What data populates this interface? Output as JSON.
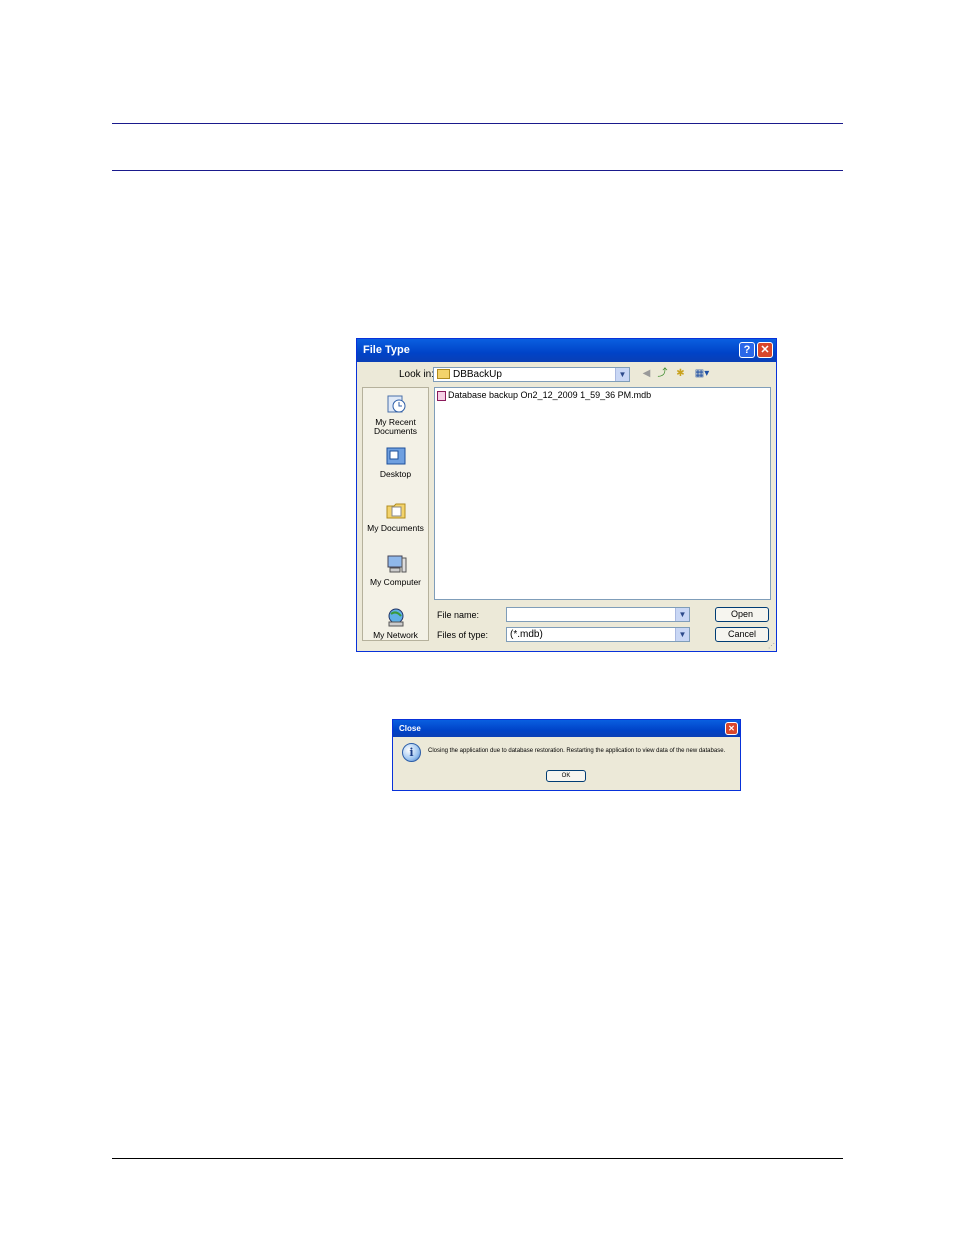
{
  "file_dialog": {
    "title": "File Type",
    "help_button": "?",
    "close_button": "✕",
    "look_in_label": "Look in:",
    "look_in_value": "DBBackUp",
    "places": [
      {
        "label": "My Recent Documents"
      },
      {
        "label": "Desktop"
      },
      {
        "label": "My Documents"
      },
      {
        "label": "My Computer"
      },
      {
        "label": "My Network"
      }
    ],
    "files": [
      "Database backup On2_12_2009 1_59_36 PM.mdb"
    ],
    "file_name_label": "File name:",
    "file_name_value": "",
    "files_of_type_label": "Files of type:",
    "files_of_type_value": "(*.mdb)",
    "open_button": "Open",
    "cancel_button": "Cancel"
  },
  "message_box": {
    "title": "Close",
    "close_button": "✕",
    "text": "Closing the application due to database restoration. Restarting the application to view data of the new database.",
    "ok_button": "OK"
  }
}
